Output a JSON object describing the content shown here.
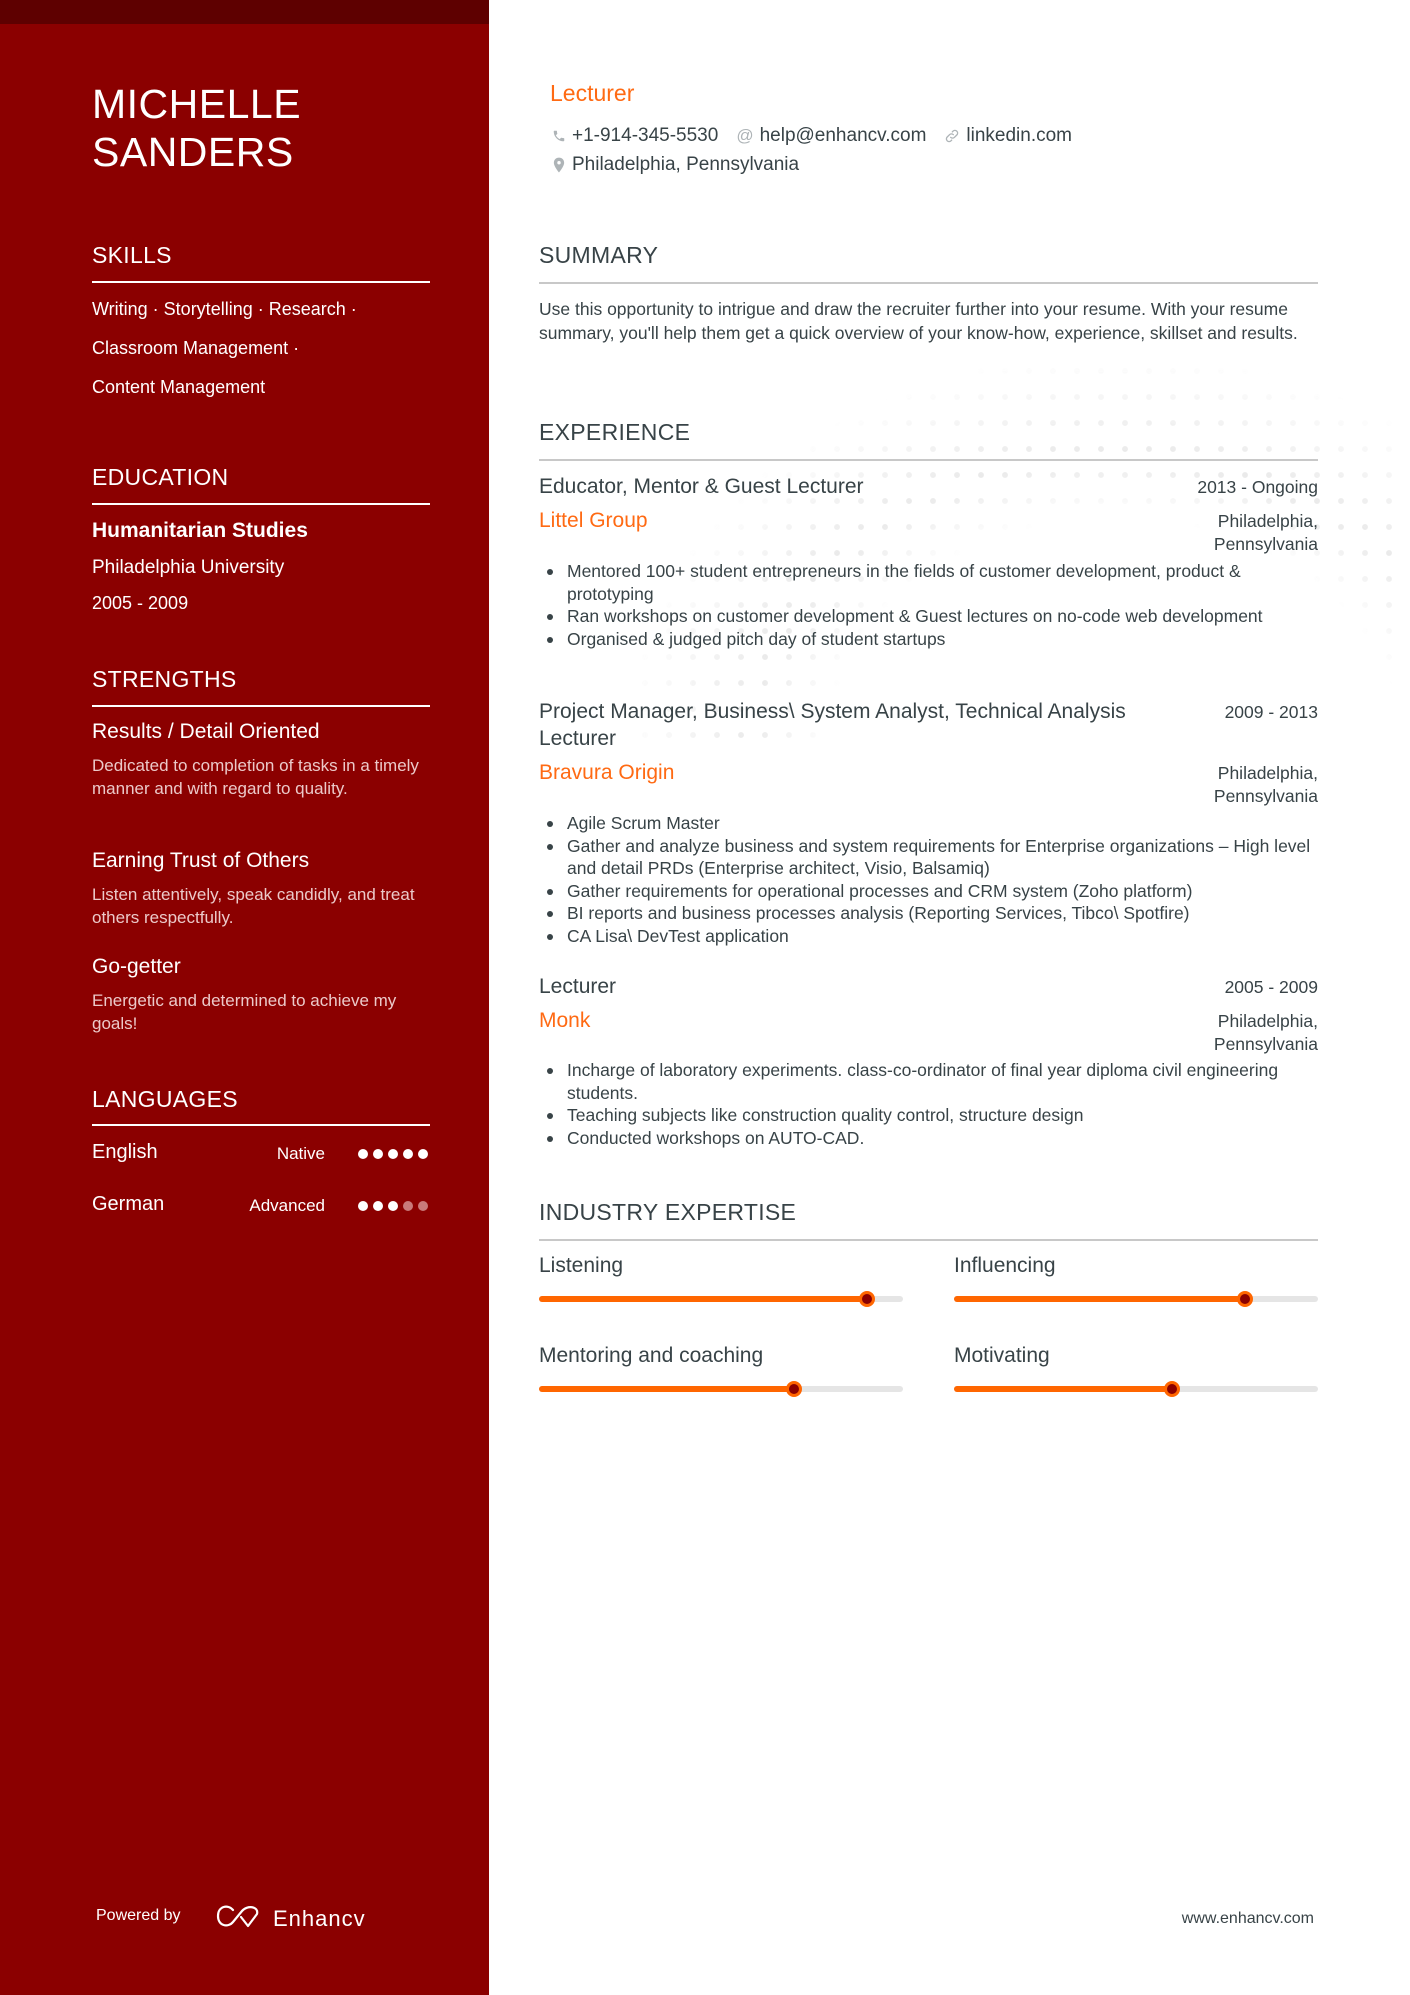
{
  "sidebar": {
    "name_line1": "MICHELLE",
    "name_line2": "SANDERS",
    "skills": {
      "heading": "SKILLS",
      "lines": [
        "Writing · Storytelling · Research ·",
        "Classroom Management ·",
        "Content Management"
      ]
    },
    "education": {
      "heading": "EDUCATION",
      "degree": "Humanitarian Studies",
      "school": "Philadelphia University",
      "dates": "2005 - 2009"
    },
    "strengths": {
      "heading": "STRENGTHS",
      "items": [
        {
          "title": "Results / Detail Oriented",
          "description": "Dedicated to completion of tasks in a timely manner and with regard to quality."
        },
        {
          "title": "Earning Trust of Others",
          "description": "Listen attentively, speak candidly, and treat others respectfully."
        },
        {
          "title": "Go-getter",
          "description": "Energetic and determined to achieve my goals!"
        }
      ]
    },
    "languages": {
      "heading": "LANGUAGES",
      "items": [
        {
          "name": "English",
          "level": "Native",
          "rating": 5,
          "max": 5
        },
        {
          "name": "German",
          "level": "Advanced",
          "rating": 3,
          "max": 5
        }
      ]
    },
    "footer": {
      "powered_by": "Powered by",
      "brand": "Enhancv"
    }
  },
  "header": {
    "title": "Lecturer",
    "phone": "+1-914-345-5530",
    "email": "help@enhancv.com",
    "link": "linkedin.com",
    "location": "Philadelphia, Pennsylvania",
    "icons": {
      "phone": "phone-icon",
      "email": "at-icon",
      "link": "link-icon",
      "location": "map-pin-icon"
    }
  },
  "summary": {
    "heading": "SUMMARY",
    "text": "Use this opportunity to intrigue and draw the recruiter further into your resume. With your resume summary, you'll help them get a quick overview of your know-how, experience, skillset and results."
  },
  "experience": {
    "heading": "EXPERIENCE",
    "jobs": [
      {
        "title": "Educator, Mentor & Guest Lecturer",
        "dates": "2013 - Ongoing",
        "company": "Littel Group",
        "location": "Philadelphia, Pennsylvania",
        "bullets": [
          "Mentored 100+ student entrepreneurs in the fields of customer development, product & prototyping",
          "Ran workshops on customer development & Guest lectures on no-code web development",
          "Organised & judged pitch day of student startups"
        ]
      },
      {
        "title": "Project Manager, Business\\ System Analyst, Technical Analysis Lecturer",
        "dates": "2009 - 2013",
        "company": "Bravura Origin",
        "location": "Philadelphia, Pennsylvania",
        "bullets": [
          "Agile Scrum Master",
          "Gather and analyze business and system requirements for Enterprise organizations – High level and detail PRDs (Enterprise architect, Visio, Balsamiq)",
          "Gather requirements for operational processes and CRM system (Zoho platform)",
          "BI reports and business processes analysis (Reporting Services, Tibco\\ Spotfire)",
          "CA Lisa\\ DevTest application"
        ]
      },
      {
        "title": "Lecturer",
        "dates": "2005 - 2009",
        "company": "Monk",
        "location": "Philadelphia, Pennsylvania",
        "bullets": [
          "Incharge of laboratory experiments. class-co-ordinator of final year diploma civil engineering students.",
          "Teaching subjects like construction quality control, structure design",
          "Conducted workshops on AUTO-CAD."
        ]
      }
    ]
  },
  "expertise": {
    "heading": "INDUSTRY EXPERTISE",
    "items": [
      {
        "label": "Listening",
        "level": 0.9
      },
      {
        "label": "Influencing",
        "level": 0.8
      },
      {
        "label": "Mentoring and coaching",
        "level": 0.7
      },
      {
        "label": "Motivating",
        "level": 0.6
      }
    ]
  },
  "footer": {
    "website": "www.enhancv.com"
  },
  "colors": {
    "sidebar": "#8b0000",
    "sidebar_top": "#5e0000",
    "accent": "#ff6a13",
    "slider_fill": "#ff6600",
    "text": "#384347"
  }
}
